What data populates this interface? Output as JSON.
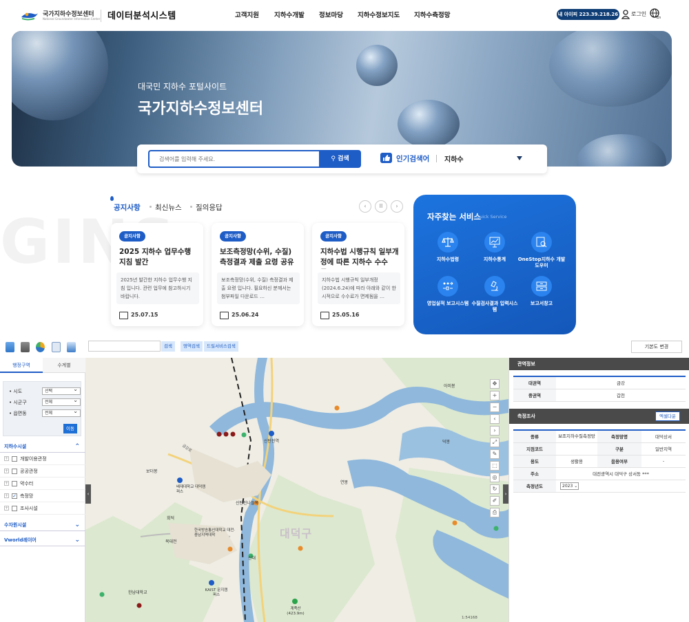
{
  "header": {
    "org_name": "국가지하수정보센터",
    "org_sub": "National Groundwater Information Center",
    "system_title": "데이터분석시스템",
    "nav": [
      "고객지원",
      "지하수개발",
      "정보마당",
      "지하수정보지도",
      "지하수측정망"
    ],
    "ip_badge": "내 아이피 223.39.218.26",
    "login": "로그인"
  },
  "hero": {
    "subtitle": "대국민 지하수 포털사이트",
    "title": "국가지하수정보센터"
  },
  "search": {
    "placeholder": "검색어를 입력해 주세요.",
    "button": "검색",
    "popular_label": "인기검색어",
    "popular_word": "지하수"
  },
  "news": {
    "watermark": "GINS",
    "tabs": [
      "공지사항",
      "최신뉴스",
      "질의응답"
    ],
    "cards": [
      {
        "badge": "공지사항",
        "title": "2025 지하수 업무수행 지침 발간",
        "body": "2025년 발간한 지하수 업무수행 지침 입니다. 관련 업무에 참고하시기 바랍니다.",
        "date": "25.07.15"
      },
      {
        "badge": "공지사항",
        "title": "보조측정망(수위, 수질) 측정결과 제출 요령 공유",
        "body": "보조측정망(수위, 수질) 측정결과 제출 요령 입니다. 필요하신 분께서는 첨부파일 다운로드 …",
        "date": "25.06.24"
      },
      {
        "badge": "공지사항",
        "title": "지하수법 시행규칙 일부개정에 따른 지하수 수수료…",
        "body": "지하수법 시행규칙 일부개정(2024.6.24)에 따라 아래와 같이 한시적으로 수수료가 면제됨을 …",
        "date": "25.05.16"
      }
    ]
  },
  "quick": {
    "title": "자주찾는 서비스",
    "subtitle": "Quick Service",
    "items": [
      {
        "label": "지하수법령",
        "icon": "scales-icon"
      },
      {
        "label": "지하수통계",
        "icon": "chart-board-icon"
      },
      {
        "label": "OneStop지하수 개발도우미",
        "icon": "search-doc-icon"
      },
      {
        "label": "영업실적 보고시스템",
        "icon": "flow-icon"
      },
      {
        "label": "수질검사결과 입력시스템",
        "icon": "microscope-icon"
      },
      {
        "label": "보고서창고",
        "icon": "archive-icon"
      }
    ]
  },
  "map_toolbar": {
    "search_btn": "검색",
    "area_btn": "영역검색",
    "drill_btn": "드릴서비스검색",
    "basemap_btn": "기본도 변경"
  },
  "left_panel": {
    "tabs": [
      "행정구역",
      "수계별"
    ],
    "region": [
      {
        "label": "• 시도",
        "value": "선택"
      },
      {
        "label": "• 시군구",
        "value": "전체"
      },
      {
        "label": "• 읍면동",
        "value": "전체"
      }
    ],
    "move_btn": "이동",
    "sections": [
      "지하수시설",
      "수자원시설",
      "Vworld레이어"
    ],
    "facilities": [
      {
        "label": "개발이용관정",
        "checked": ""
      },
      {
        "label": "공공관정",
        "checked": ""
      },
      {
        "label": "약수터",
        "checked": ""
      },
      {
        "label": "측정망",
        "checked": "✓"
      },
      {
        "label": "조사시설",
        "checked": ""
      }
    ]
  },
  "map": {
    "labels": [
      "신탄진역",
      "보더봉",
      "배재대학교 대덕캠퍼스",
      "회덕",
      "한국방송통신대학교 대전·충남지역대학",
      "북대전",
      "대덕구",
      "신탄진나들목",
      "신대",
      "KAIST 문지캠퍼스",
      "계족산 (423.9m)",
      "아미봉",
      "연봉",
      "덕봉",
      "금강로",
      "한남대학교"
    ],
    "scale": "1:54168"
  },
  "right_panel": {
    "area_title": "관역정보",
    "area_rows": [
      {
        "k": "대권역",
        "v": "금강"
      },
      {
        "k": "중권역",
        "v": "갑천"
      }
    ],
    "survey_title": "측정조사",
    "excel_btn": "엑셀다운",
    "survey_rows": [
      {
        "k1": "종류",
        "v1": "보조지하수질측정망",
        "k2": "측정망명",
        "v2": "대덕상서"
      },
      {
        "k1": "지점코드",
        "v1": "",
        "k2": "구분",
        "v2": "일반지역"
      },
      {
        "k1": "용도",
        "v1": "생활용",
        "k2": "음용여부",
        "v2": "-"
      }
    ],
    "address_label": "주소",
    "address": "대전광역시 대덕구 상서동 ***",
    "year_label": "측정년도",
    "year": "2023"
  },
  "colors": {
    "brand": "#1e5cc6",
    "header_navy": "#0f3d75",
    "quick_bg": "#1668d0"
  }
}
